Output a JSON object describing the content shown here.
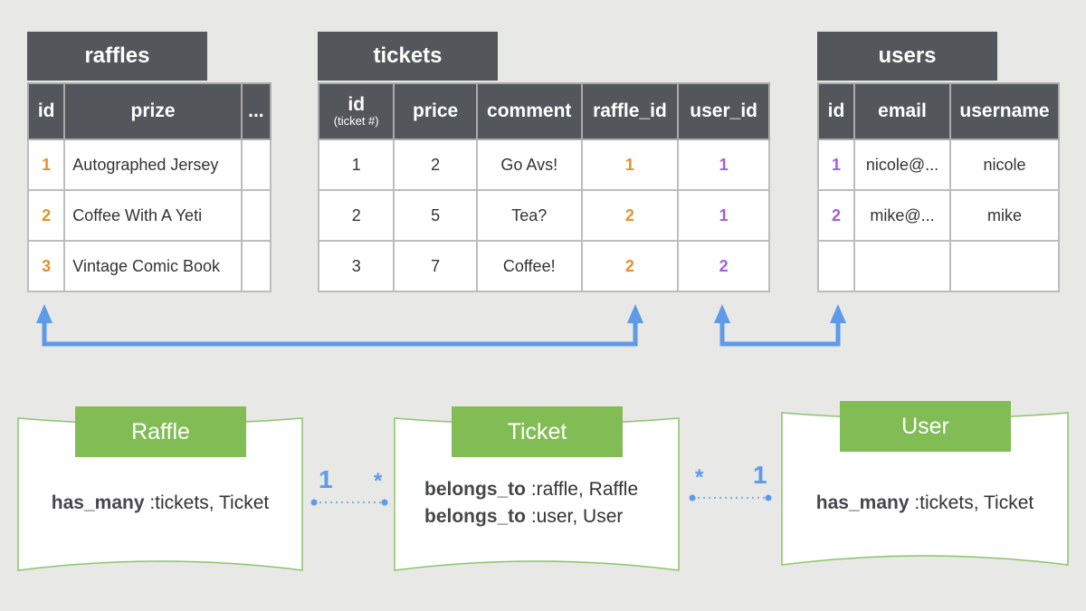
{
  "tables": {
    "raffles": {
      "title": "raffles",
      "columns": [
        "id",
        "prize",
        "..."
      ],
      "rows": [
        [
          "1",
          "Autographed Jersey",
          ""
        ],
        [
          "2",
          "Coffee With A Yeti",
          ""
        ],
        [
          "3",
          "Vintage Comic Book",
          ""
        ]
      ]
    },
    "tickets": {
      "title": "tickets",
      "columns": [
        "id",
        "price",
        "comment",
        "raffle_id",
        "user_id"
      ],
      "id_subtitle": "(ticket #)",
      "rows": [
        [
          "1",
          "2",
          "Go Avs!",
          "1",
          "1"
        ],
        [
          "2",
          "5",
          "Tea?",
          "2",
          "1"
        ],
        [
          "3",
          "7",
          "Coffee!",
          "2",
          "2"
        ]
      ]
    },
    "users": {
      "title": "users",
      "columns": [
        "id",
        "email",
        "username"
      ],
      "rows": [
        [
          "1",
          "nicole@...",
          "nicole"
        ],
        [
          "2",
          "mike@...",
          "mike"
        ],
        [
          "",
          "",
          ""
        ]
      ]
    }
  },
  "models": {
    "raffle": {
      "label": "Raffle",
      "lines": [
        {
          "keyword": "has_many",
          "args": " :tickets, Ticket"
        }
      ]
    },
    "ticket": {
      "label": "Ticket",
      "lines": [
        {
          "keyword": "belongs_to",
          "args": " :raffle, Raffle"
        },
        {
          "keyword": "belongs_to",
          "args": " :user, User"
        }
      ]
    },
    "user": {
      "label": "User",
      "lines": [
        {
          "keyword": "has_many",
          "args": " :tickets, Ticket"
        }
      ]
    }
  },
  "associations": {
    "raffle_ticket": {
      "left": "1",
      "right": "*"
    },
    "ticket_user": {
      "left": "*",
      "right": "1"
    }
  },
  "colors": {
    "raffle_fk": "#e8902a",
    "user_fk": "#a25fd6",
    "arrow": "#5d9ae8",
    "model_header": "#82bc55",
    "table_header": "#53565b"
  }
}
